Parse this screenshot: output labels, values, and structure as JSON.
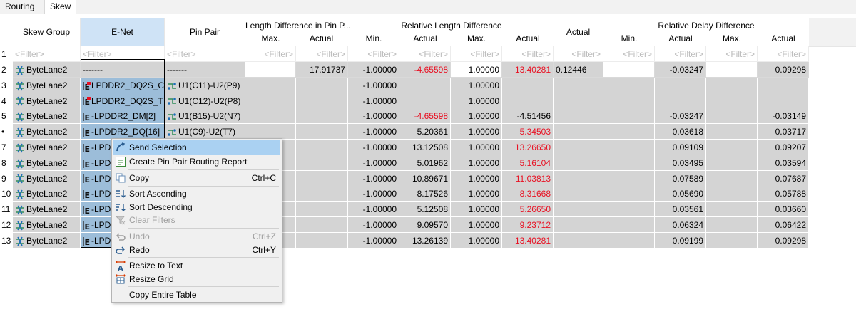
{
  "tabs": [
    {
      "label": "Routing",
      "active": false
    },
    {
      "label": "Skew",
      "active": true
    }
  ],
  "columns": {
    "skew_group": "Skew Group",
    "enet": "E-Net",
    "pin_pair": "Pin Pair",
    "len_diff_group": "Length Difference in Pin P...",
    "len_diff_max": "Max.",
    "len_diff_actual": "Actual",
    "rel_len_group": "Relative Length Difference",
    "rel_len_min": "Min.",
    "rel_len_actual": "Actual",
    "rel_len_max": "Max.",
    "rel_len_actual2": "Actual",
    "actual": "Actual",
    "rel_delay_group": "Relative Delay Difference",
    "rel_delay_min": "Min.",
    "rel_delay_actual": "Actual",
    "rel_delay_max": "Max.",
    "rel_delay_actual2": "Actual"
  },
  "filter_text": "<Filter>",
  "rows": [
    {
      "num": "2",
      "group": "ByteLane2",
      "enet": "-------",
      "pin": "-------",
      "ld_actual": "17.91737",
      "rl_min": "-1.00000",
      "rl_actual": "-4.65598",
      "rl_actual_red": true,
      "rl_max": "1.00000",
      "rl_actual2": "13.40281",
      "rl_actual2_red": true,
      "actual": "0.12446",
      "rd_actual": "-0.03247",
      "rd_actual2": "0.09298"
    },
    {
      "num": "3",
      "group": "ByteLane2",
      "enet": "LPDDR2_DQ2S_C",
      "pin": "U1(C11)-U2(P9)",
      "ld_actual": "",
      "rl_min": "-1.00000",
      "rl_actual": "",
      "rl_actual_red": false,
      "rl_max": "1.00000",
      "rl_actual2": "",
      "rl_actual2_red": false,
      "actual": "",
      "rd_actual": "",
      "rd_actual2": ""
    },
    {
      "num": "4",
      "group": "ByteLane2",
      "enet": "LPDDR2_DQ2S_T",
      "pin": "U1(C12)-U2(P8)",
      "ld_actual": "",
      "rl_min": "-1.00000",
      "rl_actual": "",
      "rl_actual_red": false,
      "rl_max": "1.00000",
      "rl_actual2": "",
      "rl_actual2_red": false,
      "actual": "",
      "rd_actual": "",
      "rd_actual2": ""
    },
    {
      "num": "5",
      "group": "ByteLane2",
      "enet": "-LPDDR2_DM[2]",
      "pin": "U1(B15)-U2(N7)",
      "ld_actual": "",
      "rl_min": "-1.00000",
      "rl_actual": "-4.65598",
      "rl_actual_red": true,
      "rl_max": "1.00000",
      "rl_actual2": "-4.51456",
      "rl_actual2_red": false,
      "actual": "",
      "rd_actual": "-0.03247",
      "rd_actual2": "-0.03149"
    },
    {
      "num": "•",
      "group": "ByteLane2",
      "enet": "-LPDDR2_DQ[16]",
      "pin": "U1(C9)-U2(T7)",
      "ld_actual": "",
      "rl_min": "-1.00000",
      "rl_actual": "5.20361",
      "rl_actual_red": false,
      "rl_max": "1.00000",
      "rl_actual2": "5.34503",
      "rl_actual2_red": true,
      "actual": "",
      "rd_actual": "0.03618",
      "rd_actual2": "0.03717"
    },
    {
      "num": "7",
      "group": "ByteLane2",
      "enet": "-LPDD",
      "pin": "",
      "ld_actual": "",
      "rl_min": "-1.00000",
      "rl_actual": "13.12508",
      "rl_actual_red": false,
      "rl_max": "1.00000",
      "rl_actual2": "13.26650",
      "rl_actual2_red": true,
      "actual": "",
      "rd_actual": "0.09109",
      "rd_actual2": "0.09207"
    },
    {
      "num": "8",
      "group": "ByteLane2",
      "enet": "-LPDD",
      "pin": "",
      "ld_actual": "",
      "rl_min": "-1.00000",
      "rl_actual": "5.01962",
      "rl_actual_red": false,
      "rl_max": "1.00000",
      "rl_actual2": "5.16104",
      "rl_actual2_red": true,
      "actual": "",
      "rd_actual": "0.03495",
      "rd_actual2": "0.03594"
    },
    {
      "num": "9",
      "group": "ByteLane2",
      "enet": "-LPDD",
      "pin": "",
      "ld_actual": "",
      "rl_min": "-1.00000",
      "rl_actual": "10.89671",
      "rl_actual_red": false,
      "rl_max": "1.00000",
      "rl_actual2": "11.03813",
      "rl_actual2_red": true,
      "actual": "",
      "rd_actual": "0.07589",
      "rd_actual2": "0.07687"
    },
    {
      "num": "10",
      "group": "ByteLane2",
      "enet": "-LPDD",
      "pin": "",
      "ld_actual": "",
      "rl_min": "-1.00000",
      "rl_actual": "8.17526",
      "rl_actual_red": false,
      "rl_max": "1.00000",
      "rl_actual2": "8.31668",
      "rl_actual2_red": true,
      "actual": "",
      "rd_actual": "0.05690",
      "rd_actual2": "0.05788"
    },
    {
      "num": "11",
      "group": "ByteLane2",
      "enet": "-LPDD",
      "pin": "",
      "ld_actual": "",
      "rl_min": "-1.00000",
      "rl_actual": "5.12508",
      "rl_actual_red": false,
      "rl_max": "1.00000",
      "rl_actual2": "5.26650",
      "rl_actual2_red": true,
      "actual": "",
      "rd_actual": "0.03561",
      "rd_actual2": "0.03660"
    },
    {
      "num": "12",
      "group": "ByteLane2",
      "enet": "-LPDD",
      "pin": "",
      "ld_actual": "",
      "rl_min": "-1.00000",
      "rl_actual": "9.09570",
      "rl_actual_red": false,
      "rl_max": "1.00000",
      "rl_actual2": "9.23712",
      "rl_actual2_red": true,
      "actual": "",
      "rd_actual": "0.06324",
      "rd_actual2": "0.06422"
    },
    {
      "num": "13",
      "group": "ByteLane2",
      "enet": "-LPDD",
      "pin": "",
      "ld_actual": "",
      "rl_min": "-1.00000",
      "rl_actual": "13.26139",
      "rl_actual_red": false,
      "rl_max": "1.00000",
      "rl_actual2": "13.40281",
      "rl_actual2_red": true,
      "actual": "",
      "rd_actual": "0.09199",
      "rd_actual2": "0.09298"
    }
  ],
  "context_menu": {
    "send_selection": "Send Selection",
    "create_report": "Create Pin Pair Routing Report",
    "copy": "Copy",
    "copy_key": "Ctrl+C",
    "sort_asc": "Sort Ascending",
    "sort_desc": "Sort Descending",
    "clear_filters": "Clear Filters",
    "undo": "Undo",
    "undo_key": "Ctrl+Z",
    "redo": "Redo",
    "redo_key": "Ctrl+Y",
    "resize_text": "Resize to Text",
    "resize_grid": "Resize Grid",
    "copy_table": "Copy Entire Table"
  },
  "colors": {
    "red_value": "#e81123",
    "selected_enet": "#9cbdd9",
    "row_gray": "#d4d4d4",
    "menu_highlight": "#aad1f2"
  },
  "icons": {
    "group_icon": "bytelane-group-icon",
    "enet_icon": "enet-icon",
    "pinpair_icon": "pin-pair-icon"
  }
}
